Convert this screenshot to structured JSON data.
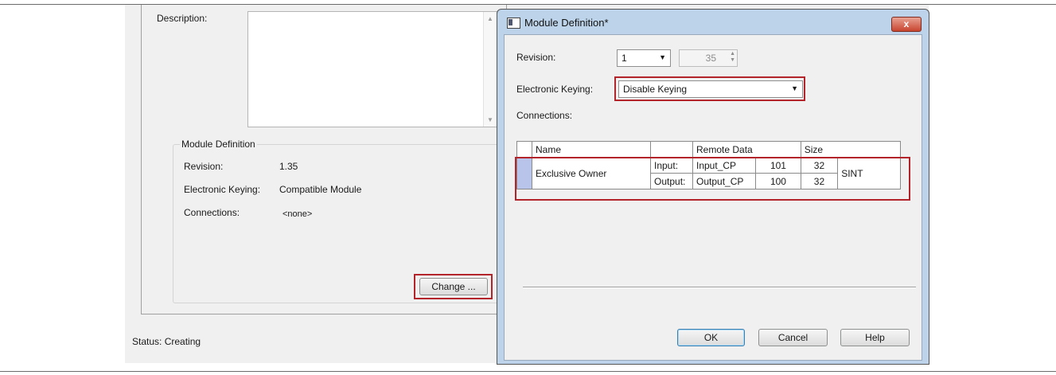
{
  "background_panel": {
    "description_label": "Description:",
    "description_value": "",
    "module_definition": {
      "title": "Module Definition",
      "revision_label": "Revision:",
      "revision_value": "1.35",
      "keying_label": "Electronic Keying:",
      "keying_value": "Compatible Module",
      "connections_label": "Connections:",
      "connections_value": "<none>",
      "change_button": "Change ..."
    },
    "status": "Status:  Creating"
  },
  "dialog": {
    "title": "Module Definition*",
    "close_glyph": "x",
    "revision_label": "Revision:",
    "revision_major": "1",
    "revision_minor": "35",
    "keying_label": "Electronic Keying:",
    "keying_value": "Disable Keying",
    "connections_label": "Connections:",
    "table": {
      "headers": [
        "Name",
        "",
        "Remote Data",
        "",
        "Size",
        ""
      ],
      "row": {
        "name": "Exclusive Owner",
        "input_label": "Input:",
        "input_tag": "Input_CP",
        "input_instance": "101",
        "input_size": "32",
        "output_label": "Output:",
        "output_tag": "Output_CP",
        "output_instance": "100",
        "output_size": "32",
        "data_type": "SINT"
      }
    },
    "buttons": {
      "ok": "OK",
      "cancel": "Cancel",
      "help": "Help"
    }
  },
  "colors": {
    "highlight_border": "#b2232a",
    "selection": "#b8c4ea",
    "dialog_frame": "#bcd3ea"
  }
}
